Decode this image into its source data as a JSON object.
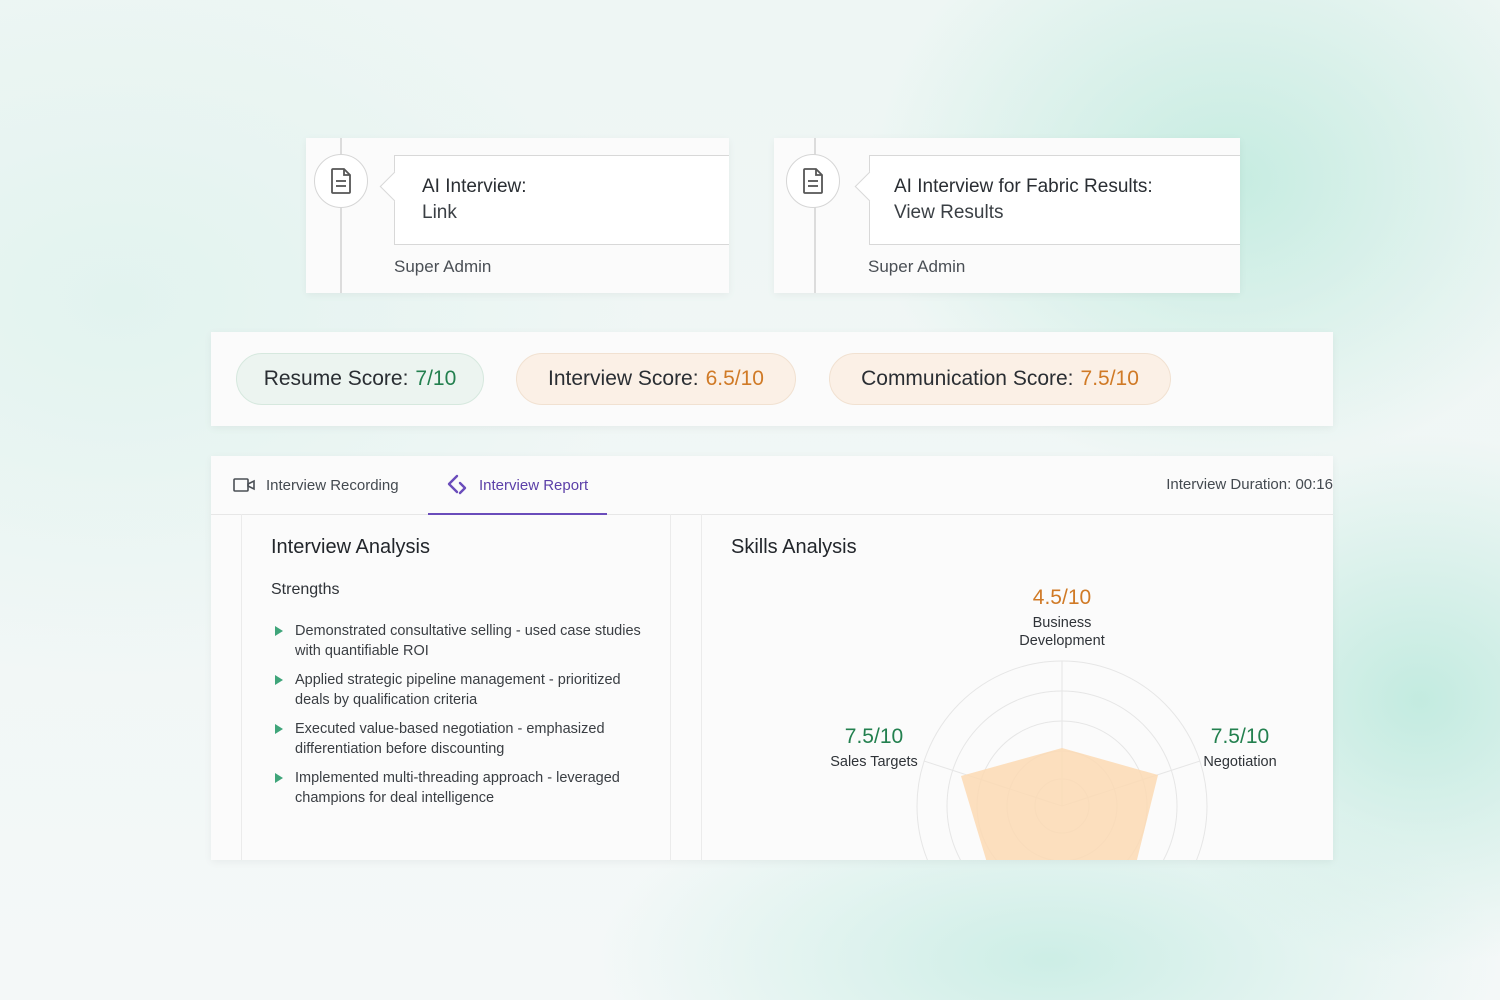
{
  "activity": [
    {
      "title": "AI Interview:",
      "subtitle": "Link",
      "author": "Super Admin",
      "icon": "document-icon"
    },
    {
      "title": "AI Interview for Fabric Results:",
      "subtitle": "View Results",
      "author": "Super Admin",
      "icon": "document-icon"
    }
  ],
  "scores": {
    "resume": {
      "label": "Resume Score:",
      "value": "7/10",
      "color": "#23804f"
    },
    "interview": {
      "label": "Interview Score:",
      "value": "6.5/10",
      "color": "#d07a26"
    },
    "communication": {
      "label": "Communication Score:",
      "value": "7.5/10",
      "color": "#d07a26"
    }
  },
  "report": {
    "tabs": [
      {
        "label": "Interview Recording",
        "icon": "video-camera-icon",
        "active": false
      },
      {
        "label": "Interview Report",
        "icon": "report-icon",
        "active": true
      }
    ],
    "duration": "Interview Duration: 00:16",
    "analysis": {
      "title": "Interview Analysis",
      "strengths_title": "Strengths",
      "strengths": [
        "Demonstrated consultative selling - used case studies with quantifiable ROI",
        "Applied strategic pipeline management - prioritized deals by qualification criteria",
        "Executed value-based negotiation - emphasized differentiation before discounting",
        "Implemented multi-threading approach - leveraged champions for deal intelligence"
      ]
    },
    "skills": {
      "title": "Skills Analysis",
      "items": [
        {
          "value": "4.5/10",
          "label": "Business Development",
          "color": "#d07a26"
        },
        {
          "value": "7.5/10",
          "label": "Sales Targets",
          "color": "#23804f"
        },
        {
          "value": "7.5/10",
          "label": "Negotiation",
          "color": "#23804f"
        }
      ]
    }
  },
  "colors": {
    "accent": "#6a4cbb",
    "good": "#23804f",
    "warn": "#d07a26",
    "radar_fill": "#fcd9b3"
  }
}
